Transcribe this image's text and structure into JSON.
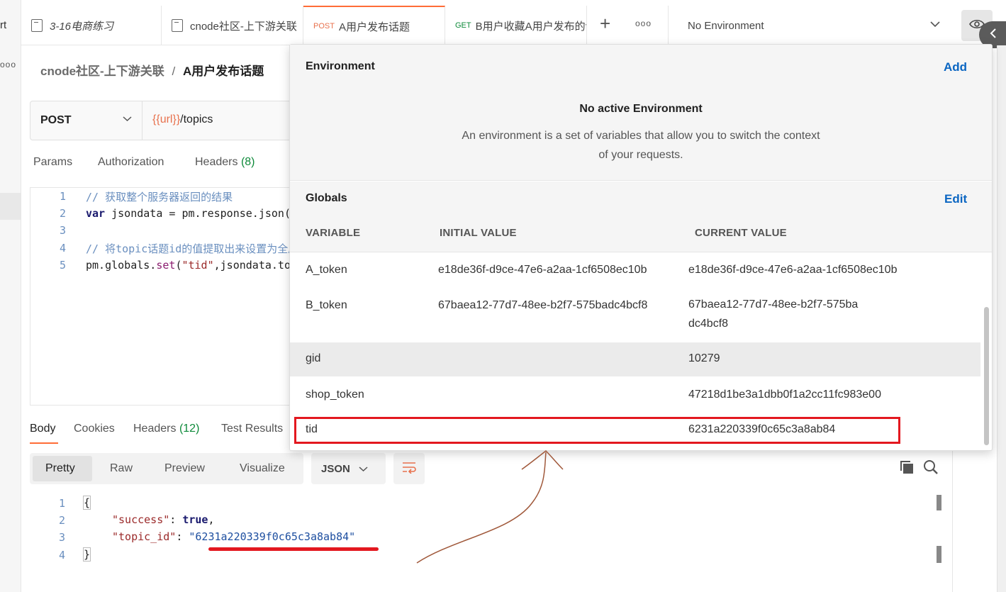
{
  "left_strip": {
    "text": "rt",
    "dots": "ooo"
  },
  "tabs": [
    {
      "method": "",
      "label": "3-16电商练习"
    },
    {
      "method": "",
      "label": "cnode社区-上下游关联"
    },
    {
      "method": "POST",
      "label": "A用户发布话题"
    },
    {
      "method": "GET",
      "label": "B用户收藏A用户发布的话题"
    }
  ],
  "tabbar": {
    "add": "+",
    "more": "ooo"
  },
  "environment_selector": {
    "value": "No Environment"
  },
  "breadcrumb": {
    "parent": "cnode社区-上下游关联",
    "separator": "/",
    "current": "A用户发布话题"
  },
  "request": {
    "method": "POST",
    "url_var": "{{url}}",
    "url_path": "/topics",
    "tabs": {
      "params": "Params",
      "authorization": "Authorization",
      "headers": "Headers",
      "headers_count": "(8)"
    }
  },
  "script_editor": {
    "line_numbers": [
      "1",
      "2",
      "3",
      "4",
      "5"
    ],
    "line1": "// 获取整个服务器返回的结果",
    "line2_kw": "var",
    "line2_rest": " jsondata = pm.response.json();",
    "line4": "// 将topic话题id的值提取出来设置为全局变量",
    "line5_a": "pm.globals.",
    "line5_fn": "set",
    "line5_b": "(",
    "line5_str": "\"tid\"",
    "line5_c": ",jsondata.topic_id);"
  },
  "response": {
    "tabs": {
      "body": "Body",
      "cookies": "Cookies",
      "headers": "Headers",
      "headers_count": "(12)",
      "test_results": "Test Results"
    },
    "modes": [
      "Pretty",
      "Raw",
      "Preview",
      "Visualize"
    ],
    "format": "JSON",
    "line_numbers": [
      "1",
      "2",
      "3",
      "4"
    ],
    "open_brace": "{",
    "key1": "\"success\"",
    "val1": "true",
    "key2": "\"topic_id\"",
    "val2": "\"6231a220339f0c65c3a8ab84\"",
    "close_brace": "}"
  },
  "env_popover": {
    "environment_title": "Environment",
    "add_label": "Add",
    "no_env_title": "No active Environment",
    "no_env_desc": "An environment is a set of variables that allow you to switch the context of your requests.",
    "globals_title": "Globals",
    "edit_label": "Edit",
    "columns": [
      "VARIABLE",
      "INITIAL VALUE",
      "CURRENT VALUE"
    ],
    "globals": [
      {
        "variable": "A_token",
        "initial": "e18de36f-d9ce-47e6-a2aa-1cf6508ec10b",
        "current": "e18de36f-d9ce-47e6-a2aa-1cf6508ec10b"
      },
      {
        "variable": "B_token",
        "initial": "67baea12-77d7-48ee-b2f7-575badc4bcf8",
        "current": "67baea12-77d7-48ee-b2f7-575badc4bcf8"
      },
      {
        "variable": "gid",
        "initial": "",
        "current": "10279"
      },
      {
        "variable": "shop_token",
        "initial": "",
        "current": "47218d1be3a1dbb0f1a2cc11fc983e00"
      },
      {
        "variable": "tid",
        "initial": "",
        "current": "6231a220339f0c65c3a8ab84"
      }
    ]
  },
  "colors": {
    "accent": "#ff6c37",
    "link": "#0b66c2",
    "highlight": "#e3181f",
    "annotation": "#a0583a"
  }
}
